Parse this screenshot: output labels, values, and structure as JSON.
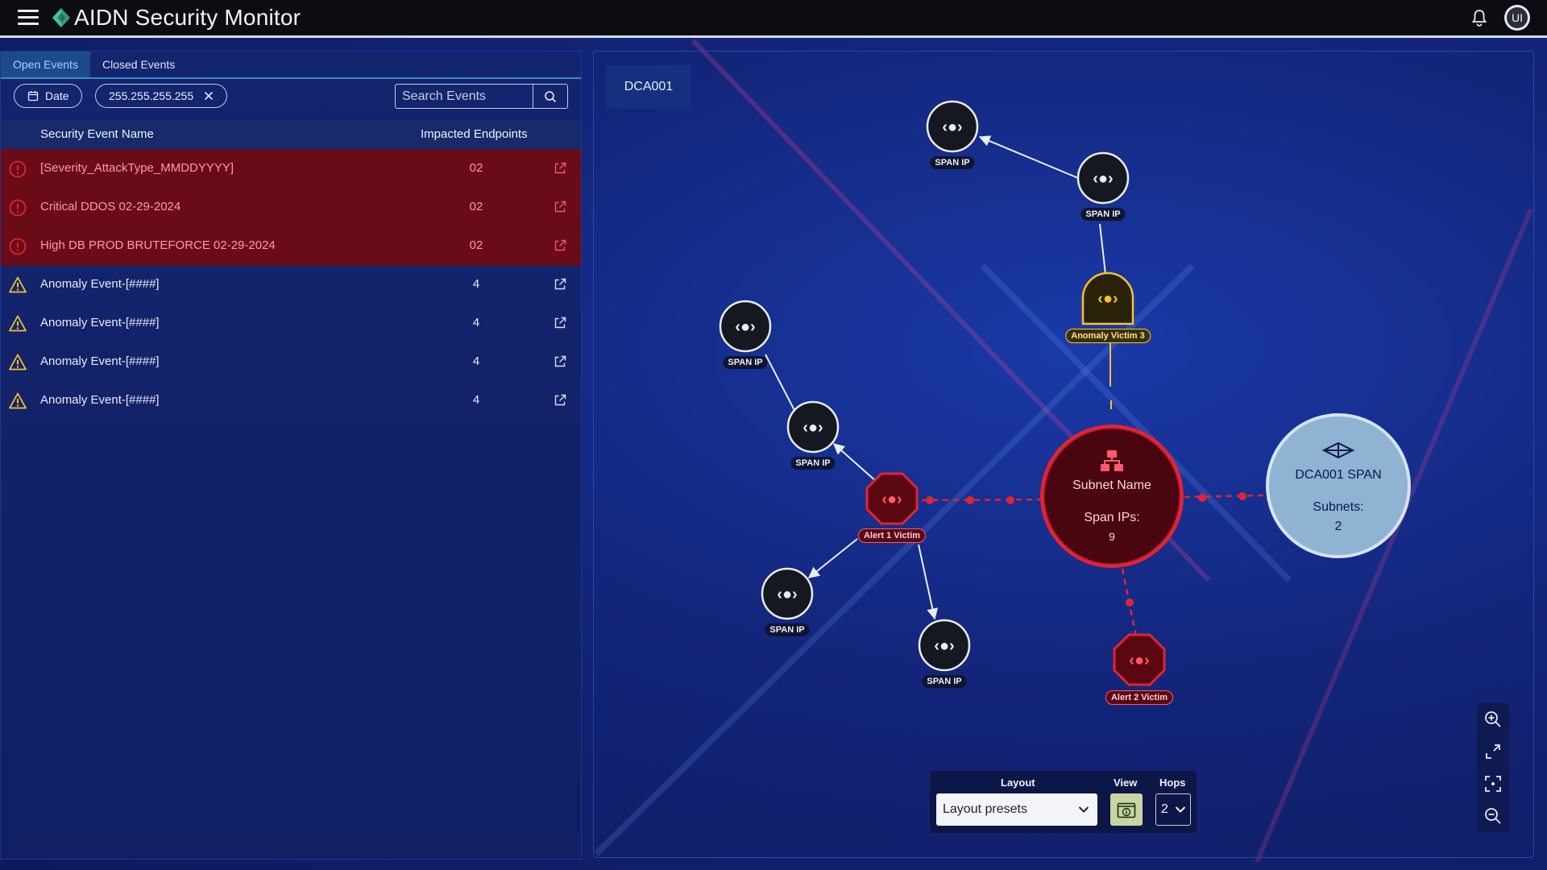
{
  "app": {
    "title": "AIDN Security Monitor",
    "user_initials": "UI"
  },
  "tabs": [
    {
      "label": "Open Events",
      "active": true
    },
    {
      "label": "Closed Events",
      "active": false
    }
  ],
  "filters": {
    "date_label": "Date",
    "ip_chip": "255.255.255.255",
    "search_placeholder": "Search Events"
  },
  "table": {
    "columns": [
      "Security Event Name",
      "Impacted Endpoints"
    ],
    "rows": [
      {
        "name": "[Severity_AttackType_MMDDYYYY]",
        "endpoints": "02",
        "severity": "critical"
      },
      {
        "name": "Critical DDOS 02-29-2024",
        "endpoints": "02",
        "severity": "critical"
      },
      {
        "name": "High DB PROD BRUTEFORCE 02-29-2024",
        "endpoints": "02",
        "severity": "critical"
      },
      {
        "name": "Anomaly Event-[####]",
        "endpoints": "4",
        "severity": "warning"
      },
      {
        "name": "Anomaly Event-[####]",
        "endpoints": "4",
        "severity": "warning"
      },
      {
        "name": "Anomaly Event-[####]",
        "endpoints": "4",
        "severity": "warning"
      },
      {
        "name": "Anomaly Event-[####]",
        "endpoints": "4",
        "severity": "warning"
      }
    ]
  },
  "graph": {
    "site": "DCA001",
    "subnet": {
      "name": "Subnet Name",
      "span_ips_label": "Span IPs:",
      "span_ips_value": "9"
    },
    "span_node": {
      "name": "DCA001 SPAN",
      "subnets_label": "Subnets:",
      "subnets_value": "2"
    },
    "nodes": {
      "span_ip_label": "SPAN IP",
      "alert1": "Alert 1 Victim",
      "alert2": "Alert 2 Victim",
      "anomaly3": "Anomaly Victim 3"
    }
  },
  "controls": {
    "layout_label": "Layout",
    "layout_value": "Layout presets",
    "view_label": "View",
    "hops_label": "Hops",
    "hops_value": "2"
  },
  "colors": {
    "critical": "#e02436",
    "warning": "#f5c32b",
    "accent": "#3b8ec4"
  }
}
